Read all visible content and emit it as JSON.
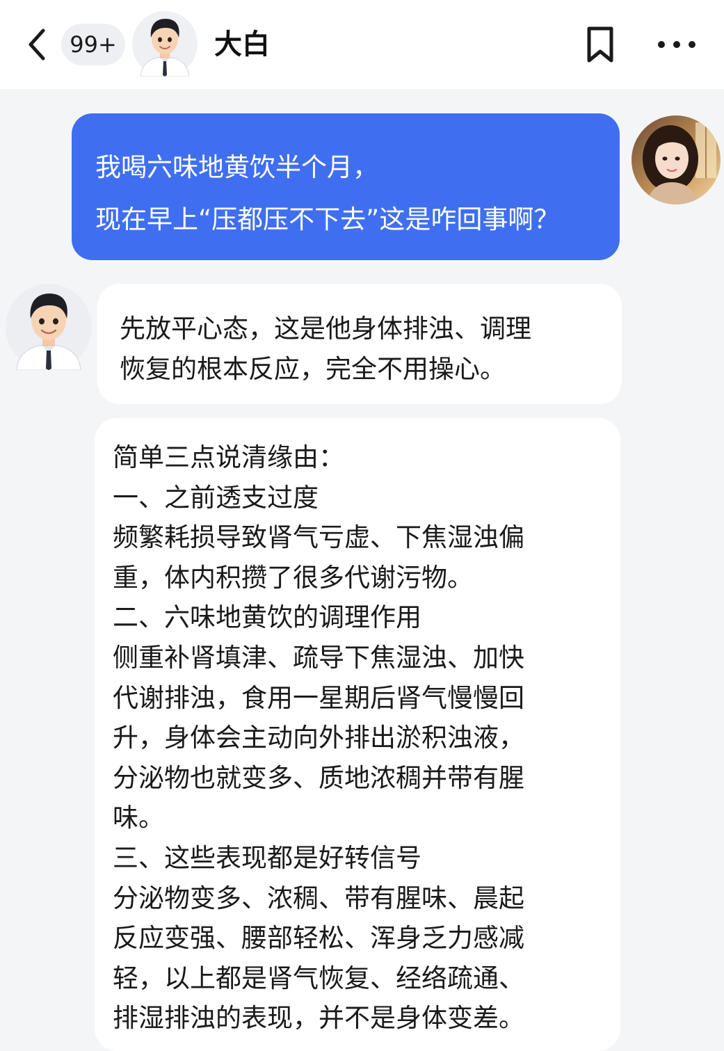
{
  "header": {
    "back_icon": "chevron-left-icon",
    "unread_count": "99+",
    "contact_name": "大白",
    "bookmark_icon": "bookmark-icon",
    "more_icon": "more-horizontal-icon"
  },
  "messages": {
    "user": {
      "lines": [
        "我喝六味地黄饮半个月，",
        "现在早上“压都压不下去”这是咋回事啊？"
      ]
    },
    "bot_1": {
      "lines": [
        "先放平心态，这是他身体排浊、调理",
        "恢复的根本反应，完全不用操心。"
      ]
    },
    "bot_2": {
      "lines": [
        "简单三点说清缘由：",
        "一、之前透支过度",
        "频繁耗损导致肾气亏虚、下焦湿浊偏",
        "重，体内积攒了很多代谢污物。",
        "二、六味地黄饮的调理作用",
        "侧重补肾填津、疏导下焦湿浊、加快",
        "代谢排浊，食用一星期后肾气慢慢回",
        "升，身体会主动向外排出淤积浊液，",
        "分泌物也就变多、质地浓稠并带有腥",
        "味。",
        "三、这些表现都是好转信号",
        "分泌物变多、浓稠、带有腥味、晨起",
        "反应变强、腰部轻松、浑身乏力感减",
        "轻，以上都是肾气恢复、经络疏通、",
        "排湿排浊的表现，并不是身体变差。"
      ]
    }
  },
  "colors": {
    "user_bubble": "#3f6ff0",
    "chat_background": "#f4f5f7",
    "bot_bubble": "#ffffff"
  }
}
